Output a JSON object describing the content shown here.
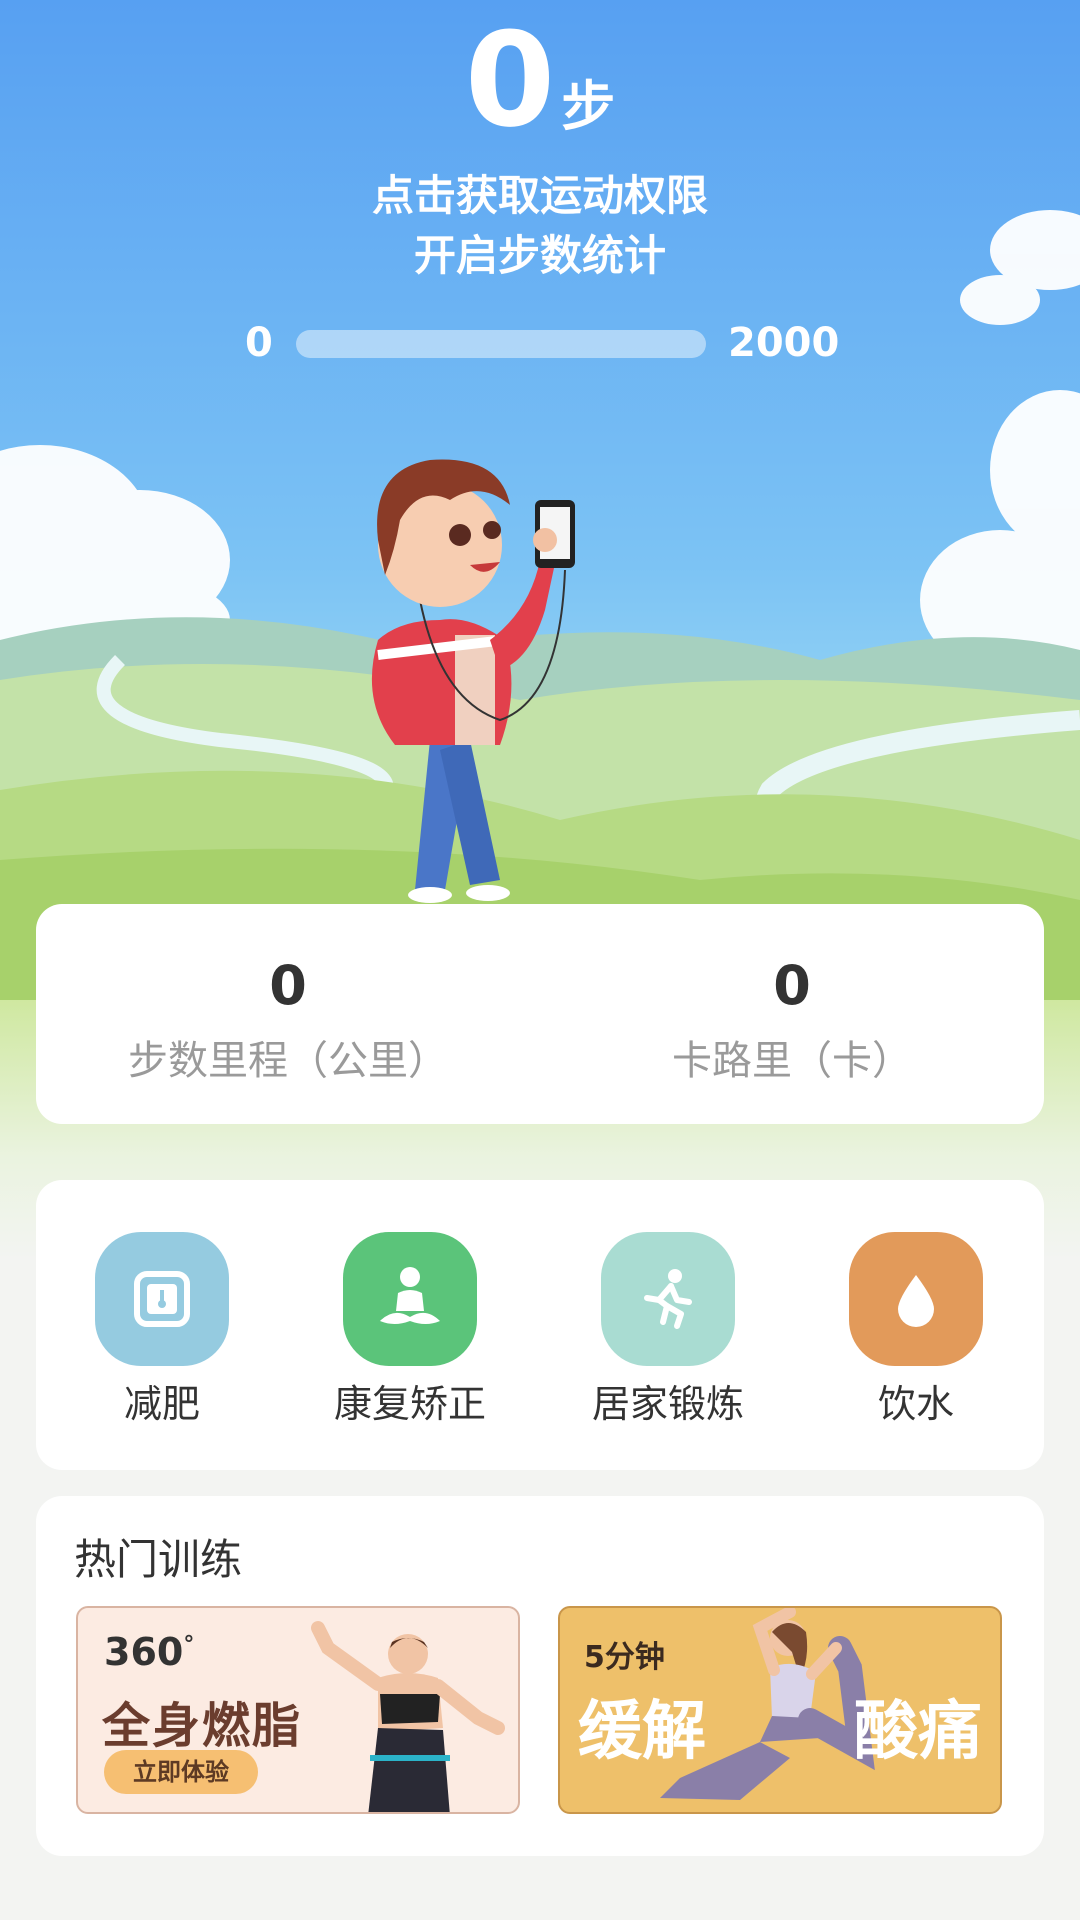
{
  "steps": {
    "value": "0",
    "unit": "步"
  },
  "permission": {
    "line1": "点击获取运动权限",
    "line2": "开启步数统计"
  },
  "progress": {
    "min": "0",
    "max": "2000",
    "current_fraction": 0
  },
  "stats": [
    {
      "value": "0",
      "label": "步数里程（公里）"
    },
    {
      "value": "0",
      "label": "卡路里（卡）"
    }
  ],
  "categories": [
    {
      "label": "减肥",
      "icon": "scale-icon",
      "color": "#95cbe0"
    },
    {
      "label": "康复矫正",
      "icon": "meditation-icon",
      "color": "#5bc47a"
    },
    {
      "label": "居家锻炼",
      "icon": "running-icon",
      "color": "#a9dcd2"
    },
    {
      "label": "饮水",
      "icon": "water-drop-icon",
      "color": "#e29a5a"
    }
  ],
  "hot_training": {
    "title": "热门训练",
    "banners": [
      {
        "tag": "360",
        "tag_suffix": "°",
        "title": "全身燃脂",
        "button": "立即体验"
      },
      {
        "tag": "5分钟",
        "title_left": "缓解",
        "title_right": "酸痛"
      }
    ]
  },
  "colors": {
    "sky_top": "#5aa2f2",
    "sky_bottom": "#a9e3f5",
    "grass": "#a7d16b",
    "page_bg": "#f3f4f2"
  }
}
